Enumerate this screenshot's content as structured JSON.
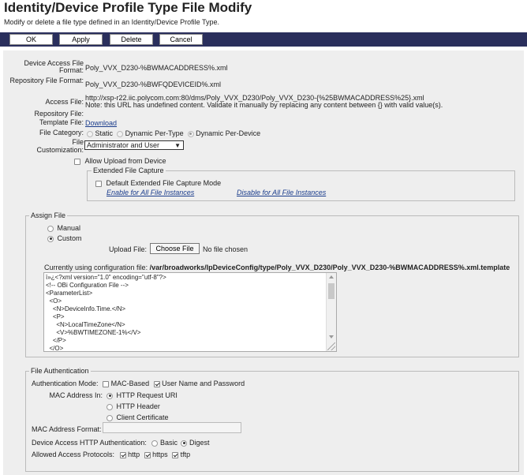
{
  "page": {
    "title": "Identity/Device Profile Type File Modify",
    "subtitle": "Modify or delete a file type defined in an Identity/Device Profile Type."
  },
  "toolbar": {
    "ok": "OK",
    "apply": "Apply",
    "delete": "Delete",
    "cancel": "Cancel"
  },
  "form": {
    "device_access_file_label": "Device Access File Format:",
    "device_access_file_value": "Poly_VVX_D230-%BWMACADDRESS%.xml",
    "repository_file_label": "Repository File Format:",
    "repository_file_value": "Poly_VVX_D230-%BWFQDEVICEID%.xml",
    "access_file_label": "Access File:",
    "access_file_url": "http://xsp-r22.iic.polycom.com:80/dms/Poly_VVX_D230/Poly_VVX_D230-{%25BWMACADDRESS%25}.xml",
    "access_file_note": "Note: this URL has undefined content. Validate it manually by replacing any content between {} with valid value(s).",
    "repo_template_label_1": "Repository File:",
    "repo_template_label_2": "Template File:",
    "repo_template_link": "Download",
    "file_category_label": "File Category:",
    "category_static": "Static",
    "category_per_type": "Dynamic Per-Type",
    "category_per_device": "Dynamic Per-Device",
    "customization_label_1": "File",
    "customization_label_2": "Customization:",
    "customization_value": "Administrator and User",
    "allow_upload_label": "Allow Upload from Device"
  },
  "extended_capture": {
    "legend": "Extended File Capture",
    "default_label": "Default Extended File Capture Mode",
    "enable_link": "Enable for All File Instances",
    "disable_link": "Disable for All File Instances"
  },
  "assign_file": {
    "legend": "Assign File",
    "manual": "Manual",
    "custom": "Custom",
    "upload_label": "Upload File:",
    "choose_button": "Choose File",
    "no_file": "No file chosen",
    "current_prefix": "Currently using configuration file: ",
    "current_path": "/var/broadworks/IpDeviceConfig/type/Poly_VVX_D230/Poly_VVX_D230-%BWMACADDRESS%.xml.template",
    "content_lines": [
      "ï»¿<?xml version=\"1.0\" encoding=\"utf-8\"?>",
      "<!-- OBi Configuration File -->",
      "<ParameterList>",
      "  <O>",
      "    <N>DeviceInfo.Time.</N>",
      "    <P>",
      "      <N>LocalTimeZone</N>",
      "      <V>%BWTIMEZONE-1%</V>",
      "    </P>",
      "  </O>"
    ]
  },
  "file_auth": {
    "legend": "File Authentication",
    "mode_label": "Authentication Mode:",
    "mac_based": "MAC-Based",
    "user_pass": "User Name and Password",
    "mac_in_label": "MAC Address In:",
    "http_request_uri": "HTTP Request URI",
    "http_header": "HTTP Header",
    "client_cert": "Client Certificate",
    "mac_format_label": "MAC Address Format:",
    "http_auth_label": "Device Access HTTP Authentication:",
    "basic": "Basic",
    "digest": "Digest",
    "protocols_label": "Allowed Access Protocols:",
    "http": "http",
    "https": "https",
    "tftp": "tftp"
  }
}
